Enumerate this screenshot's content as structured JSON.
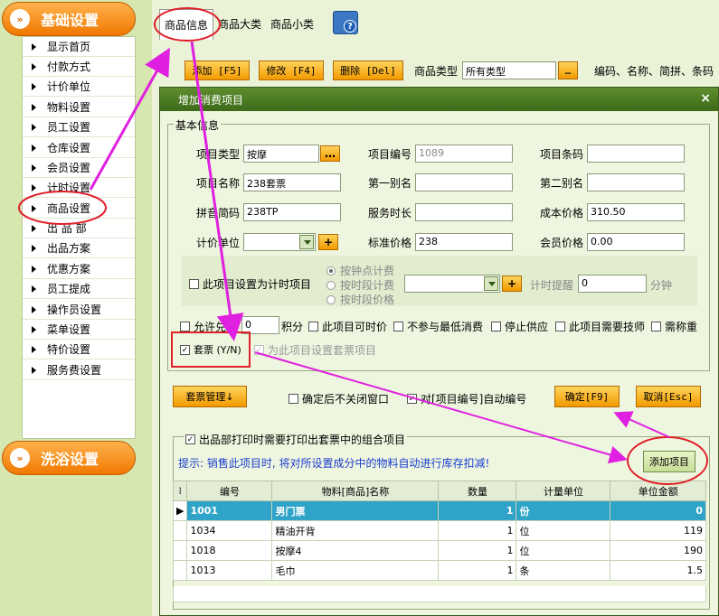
{
  "sidebar": {
    "section1_title": "基础设置",
    "items": [
      {
        "label": "显示首页"
      },
      {
        "label": "付款方式"
      },
      {
        "label": "计价单位"
      },
      {
        "label": "物料设置"
      },
      {
        "label": "员工设置"
      },
      {
        "label": "仓库设置"
      },
      {
        "label": "会员设置"
      },
      {
        "label": "计时设置"
      },
      {
        "label": "商品设置"
      },
      {
        "label": "出 品 部"
      },
      {
        "label": "出品方案"
      },
      {
        "label": "优惠方案"
      },
      {
        "label": "员工提成"
      },
      {
        "label": "操作员设置"
      },
      {
        "label": "菜单设置"
      },
      {
        "label": "特价设置"
      },
      {
        "label": "服务费设置"
      }
    ],
    "section2_title": "洗浴设置"
  },
  "tabs": [
    "商品信息",
    "商品大类",
    "商品小类"
  ],
  "toolbar": {
    "add": "添加 [F5]",
    "edit": "修改 [F4]",
    "delete": "删除 [Del]",
    "type_label": "商品类型",
    "type_value": "所有类型",
    "search_hint": "编码、名称、简拼、条码"
  },
  "dialog": {
    "title": "增加消费项目",
    "close": "×",
    "basic_group": "基本信息",
    "labels": {
      "item_type": "项目类型",
      "item_code": "项目编号",
      "barcode": "项目条码",
      "item_name": "项目名称",
      "alias1": "第一别名",
      "alias2": "第二别名",
      "pinyin": "拼音简码",
      "service_time": "服务时长",
      "cost_price": "成本价格",
      "unit": "计价单位",
      "std_price": "标准价格",
      "member_price": "会员价格"
    },
    "values": {
      "item_type": "按摩",
      "item_code": "1089",
      "barcode": "",
      "item_name": "238套票",
      "alias1": "",
      "alias2": "",
      "pinyin": "238TP",
      "service_time": "",
      "cost_price": "310.50",
      "unit": "",
      "std_price": "238",
      "member_price": "0.00"
    },
    "timing": {
      "checkbox": "此项目设置为计时项目",
      "radio1": "按钟点计费",
      "radio2": "按时段计费",
      "radio3": "按时段价格",
      "remind_label": "计时提醒",
      "remind_value": "0",
      "remind_unit": "分钟"
    },
    "options": {
      "exchange": "允许兑换",
      "exchange_value": "0",
      "points": "积分",
      "timed_price": "此项目可时价",
      "no_min": "不参与最低消费",
      "stop_supply": "停止供应",
      "need_tech": "此项目需要技师",
      "need_weigh": "需称重",
      "package": "套票 (Y/N)",
      "set_package": "为此项目设置套票项目"
    },
    "buttons": {
      "package_mgmt": "套票管理↓",
      "no_close": "确定后不关闭窗口",
      "auto_number": "对[项目编号]自动编号",
      "ok": "确定[F9]",
      "cancel": "取消[Esc]",
      "add_item": "添加项目"
    },
    "combo": {
      "checkbox": "出品部打印时需要打印出套票中的组合项目",
      "hint": "提示: 销售此项目时, 将对所设置成分中的物料自动进行库存扣减!",
      "columns": [
        "编号",
        "物料[商品]名称",
        "数量",
        "计量单位",
        "单位金额"
      ],
      "rows": [
        {
          "code": "1001",
          "name": "男门票",
          "qty": "1",
          "unit": "份",
          "price": "0"
        },
        {
          "code": "1034",
          "name": "精油开背",
          "qty": "1",
          "unit": "位",
          "price": "119"
        },
        {
          "code": "1018",
          "name": "按摩4",
          "qty": "1",
          "unit": "位",
          "price": "190"
        },
        {
          "code": "1013",
          "name": "毛巾",
          "qty": "1",
          "unit": "条",
          "price": "1.5"
        }
      ]
    }
  },
  "colors": {
    "accent": "#f39a00",
    "annotation": "#e020e0",
    "highlight_red": "#e0202a",
    "selected_row": "#2fa3c8"
  }
}
